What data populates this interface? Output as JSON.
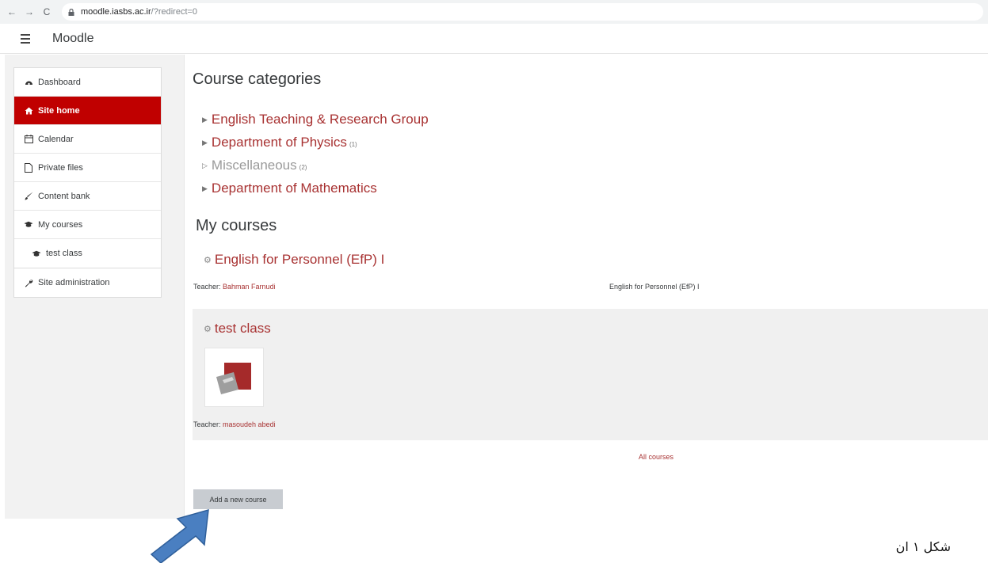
{
  "browser": {
    "url_host": "moodle.iasbs.ac.ir",
    "url_path": "/?redirect=0"
  },
  "navbar": {
    "brand": "Moodle"
  },
  "drawer": {
    "items": [
      {
        "label": "Dashboard",
        "icon": "dashboard-icon"
      },
      {
        "label": "Site home",
        "icon": "home-icon",
        "active": true
      },
      {
        "label": "Calendar",
        "icon": "calendar-icon"
      },
      {
        "label": "Private files",
        "icon": "file-icon"
      },
      {
        "label": "Content bank",
        "icon": "brush-icon"
      },
      {
        "label": "My courses",
        "icon": "graduation-cap-icon"
      },
      {
        "label": "test class",
        "icon": "graduation-cap-icon"
      }
    ],
    "admin": {
      "label": "Site administration",
      "icon": "wrench-icon"
    }
  },
  "main": {
    "categories_heading": "Course categories",
    "categories": [
      {
        "name": "English Teaching & Research Group",
        "count": ""
      },
      {
        "name": "Department of Physics",
        "count": "(1)"
      },
      {
        "name": "Miscellaneous",
        "count": "(2)"
      },
      {
        "name": "Department of Mathematics",
        "count": ""
      }
    ],
    "my_courses_heading": "My courses",
    "courses": [
      {
        "title": "English for Personnel (EfP) I",
        "teacher_label": "Teacher: ",
        "teacher_name": "Bahman Farnudi",
        "summary": "English for Personnel (EfP) I"
      },
      {
        "title": "test class",
        "teacher_label": "Teacher: ",
        "teacher_name": "masoudeh abedi"
      }
    ],
    "all_courses": "All courses",
    "add_course_button": "Add a new course"
  },
  "colors": {
    "accent": "#a83232",
    "active_nav": "#c00000",
    "arrow": "#4a7fc1"
  },
  "caption": "شکل ۱ ان"
}
